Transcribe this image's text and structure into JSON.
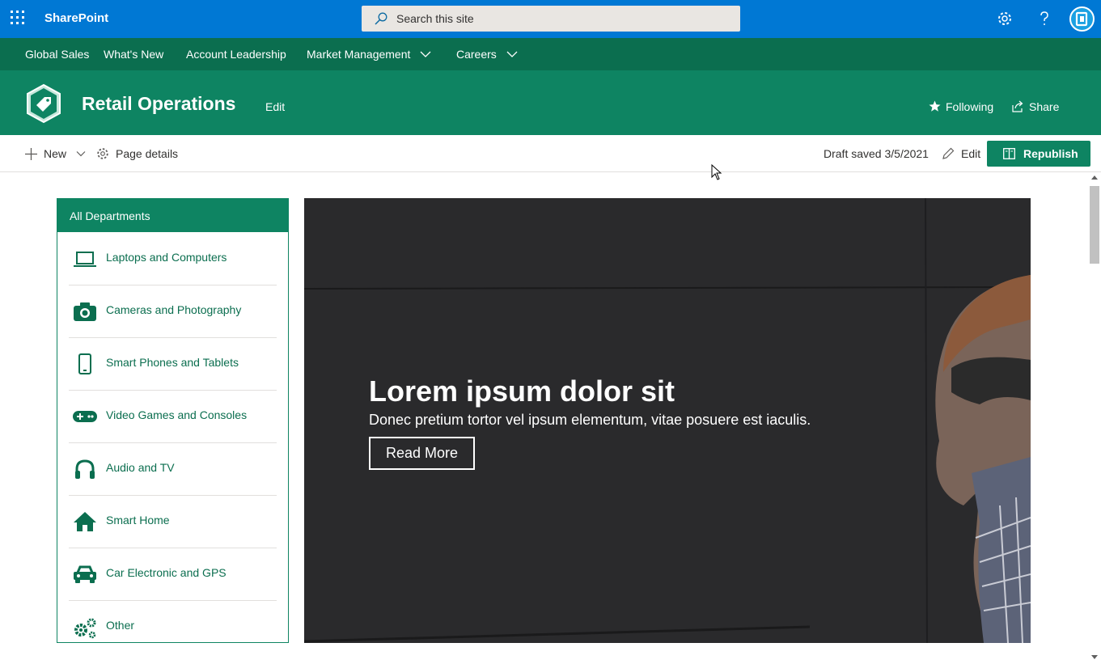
{
  "suite": {
    "app_title": "SharePoint",
    "search_placeholder": "Search this site",
    "brand_color": "#0078d4"
  },
  "hub_nav": {
    "items": [
      {
        "label": "Global Sales"
      },
      {
        "label": "What's New"
      },
      {
        "label": "Account Leadership"
      },
      {
        "label": "Market Management"
      },
      {
        "label": "Careers"
      }
    ]
  },
  "site_header": {
    "title": "Retail Operations",
    "edit_label": "Edit",
    "following_label": "Following",
    "share_label": "Share",
    "theme_color": "#0e8462"
  },
  "command_bar": {
    "new_label": "New",
    "page_details_label": "Page details",
    "draft_status": "Draft saved 3/5/2021",
    "edit_label": "Edit",
    "republish_label": "Republish"
  },
  "departments": {
    "heading": "All Departments",
    "items": [
      {
        "label": "Laptops and Computers",
        "icon": "laptop-icon"
      },
      {
        "label": "Cameras and Photography",
        "icon": "camera-icon"
      },
      {
        "label": "Smart Phones and Tablets",
        "icon": "phone-icon"
      },
      {
        "label": "Video Games and Consoles",
        "icon": "gamepad-icon"
      },
      {
        "label": "Audio and TV",
        "icon": "headphones-icon"
      },
      {
        "label": "Smart Home",
        "icon": "home-icon"
      },
      {
        "label": "Car Electronic and GPS",
        "icon": "car-icon"
      },
      {
        "label": "Other",
        "icon": "gears-icon"
      }
    ]
  },
  "hero": {
    "title": "Lorem ipsum dolor sit",
    "subtitle": "Donec pretium tortor vel ipsum elementum, vitae posuere est iaculis.",
    "button_label": "Read More"
  }
}
